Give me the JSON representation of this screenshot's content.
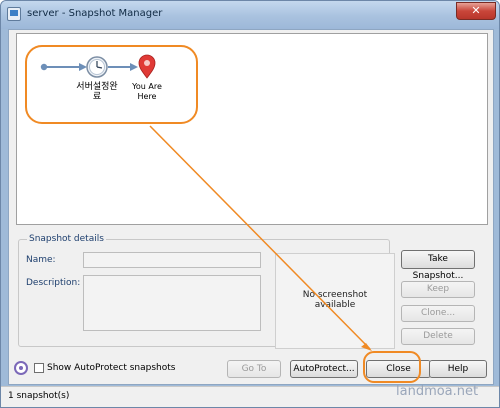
{
  "window": {
    "title": "server - Snapshot Manager"
  },
  "tree": {
    "snapshot_label": [
      "서버설정완",
      "료"
    ],
    "here_label": [
      "You Are",
      "Here"
    ]
  },
  "details": {
    "legend": "Snapshot details",
    "name_label": "Name:",
    "description_label": "Description:",
    "no_screenshot": [
      "No screenshot",
      "available"
    ]
  },
  "buttons": {
    "take_snapshot": "Take Snapshot...",
    "keep": "Keep",
    "clone": "Clone...",
    "delete": "Delete",
    "go_to": "Go To",
    "autoprotect": "AutoProtect...",
    "close": "Close",
    "help": "Help"
  },
  "options": {
    "show_autoprotect": "Show AutoProtect snapshots",
    "show_autoprotect_checked": false
  },
  "status": {
    "text": "1 snapshot(s)"
  },
  "watermark": "landmoa.net",
  "colors": {
    "annotation": "#f08a24",
    "pin": "#e03a36",
    "connector": "#6d8fb8"
  }
}
